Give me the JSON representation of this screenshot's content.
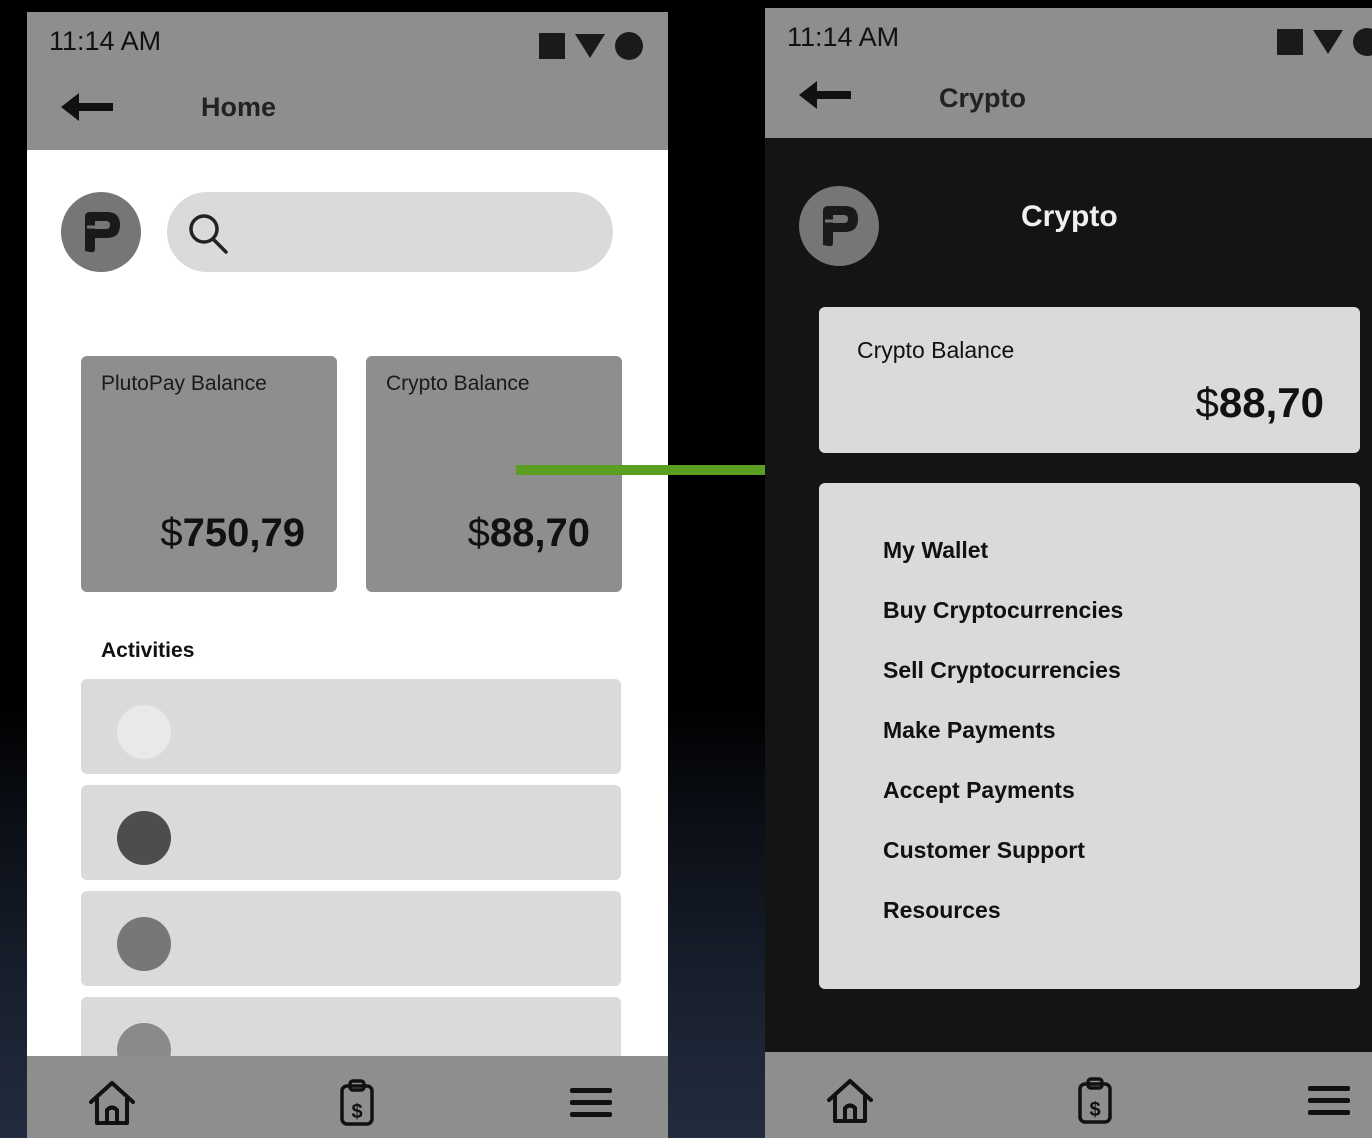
{
  "left_screen": {
    "status_bar": {
      "time": "11:14 AM"
    },
    "app_bar": {
      "title": "Home"
    },
    "search": {
      "placeholder": ""
    },
    "balances": [
      {
        "label": "PlutoPay Balance",
        "currency": "$",
        "amount": "750,79"
      },
      {
        "label": "Crypto Balance",
        "currency": "$",
        "amount": "88,70"
      }
    ],
    "activities": {
      "label": "Activities",
      "avatar_colors": [
        "#e9e9e9",
        "#4d4d4d",
        "#777777",
        "#8a8a8a"
      ]
    }
  },
  "right_screen": {
    "status_bar": {
      "time": "11:14 AM"
    },
    "app_bar": {
      "title": "Crypto"
    },
    "header": {
      "title": "Crypto"
    },
    "balance_card": {
      "label": "Crypto Balance",
      "currency": "$",
      "amount": "88,70"
    },
    "menu": {
      "items": [
        "My Wallet",
        "Buy Cryptocurrencies",
        "Sell Cryptocurrencies",
        "Make Payments",
        "Accept Payments",
        "Customer Support",
        "Resources"
      ]
    }
  },
  "flow_arrow": {
    "color": "#5a9e22"
  },
  "icons": [
    "back-arrow-icon",
    "logo-icon",
    "search-icon",
    "home-icon",
    "clipboard-dollar-icon",
    "hamburger-menu-icon"
  ]
}
